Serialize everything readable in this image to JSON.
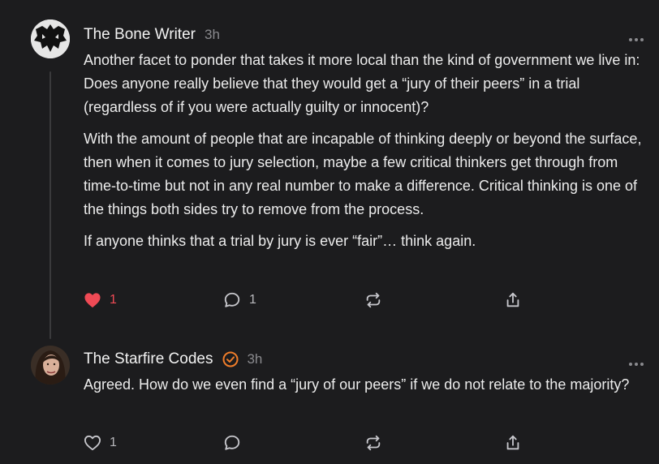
{
  "comments": [
    {
      "author": "The Bone Writer",
      "time": "3h",
      "paragraphs": [
        "Another facet to ponder that takes it more local than the kind of government we live in: Does anyone really believe that they would get a “jury of their peers” in a trial (regardless of if you were actually guilty or innocent)?",
        "With the amount of people that are incapable of thinking deeply or beyond the surface, then when it comes to jury selection, maybe a few critical thinkers get through from time-to-time but not in any real number to make a difference. Critical thinking is one of the things both sides try to remove from the process.",
        "If anyone thinks that a trial by jury is ever “fair”… think again."
      ],
      "likes": "1",
      "liked": true,
      "replies": "1"
    },
    {
      "author": "The Starfire Codes",
      "verified": true,
      "time": "3h",
      "paragraphs": [
        "Agreed. How do we even find a “jury of our peers” if we do not relate to the majority?"
      ],
      "likes": "1",
      "liked": false,
      "replies": ""
    }
  ],
  "colors": {
    "background": "#1c1c1e",
    "like_active": "#ef4a55",
    "verified_badge": "#f07d2a",
    "muted": "#8a8a8e"
  },
  "icons": [
    "heart-icon",
    "comment-bubble-icon",
    "restack-icon",
    "share-icon",
    "more-options-icon",
    "verified-badge-icon"
  ]
}
